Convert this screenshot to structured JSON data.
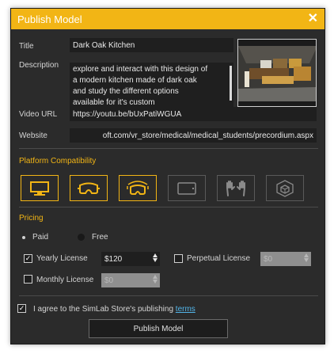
{
  "dialog": {
    "title": "Publish Model",
    "close_glyph": "✕"
  },
  "form": {
    "title_label": "Title",
    "title_value": "Dark Oak Kitchen",
    "description_label": "Description",
    "description_value": "explore and interact with this design of\na modern kitchen made of dark oak\nand study the different options\navailable for it's custom",
    "video_label": "Video URL",
    "video_value": "https://youtu.be/bUxPatiWGUA",
    "website_label": "Website",
    "website_value": "oft.com/vr_store/medical/medical_students/precordium.aspx"
  },
  "platform": {
    "section_title": "Platform Compatibility",
    "items": [
      {
        "icon": "desktop-monitor-icon",
        "active": true
      },
      {
        "icon": "vr-headset-icon",
        "active": true
      },
      {
        "icon": "vr-headset-tracked-icon",
        "active": true
      },
      {
        "icon": "tablet-icon",
        "active": false
      },
      {
        "icon": "hand-tracking-icon",
        "active": false
      },
      {
        "icon": "ar-cube-icon",
        "active": false
      }
    ]
  },
  "pricing": {
    "section_title": "Pricing",
    "paid_label": "Paid",
    "free_label": "Free",
    "selected": "Paid",
    "yearly_label": "Yearly License",
    "yearly_value": "$120",
    "yearly_checked": true,
    "perpetual_label": "Perpetual License",
    "perpetual_value": "$0",
    "perpetual_checked": false,
    "monthly_label": "Monthly License",
    "monthly_value": "$0",
    "monthly_checked": false
  },
  "agreement": {
    "text": "I agree to the SimLab Store's publishing ",
    "link": "terms",
    "checked": true
  },
  "publish_button": "Publish Model",
  "colors": {
    "accent": "#f2b515",
    "panel": "#2b2b2b",
    "field": "#1f1f1f",
    "link": "#52b4e8"
  }
}
